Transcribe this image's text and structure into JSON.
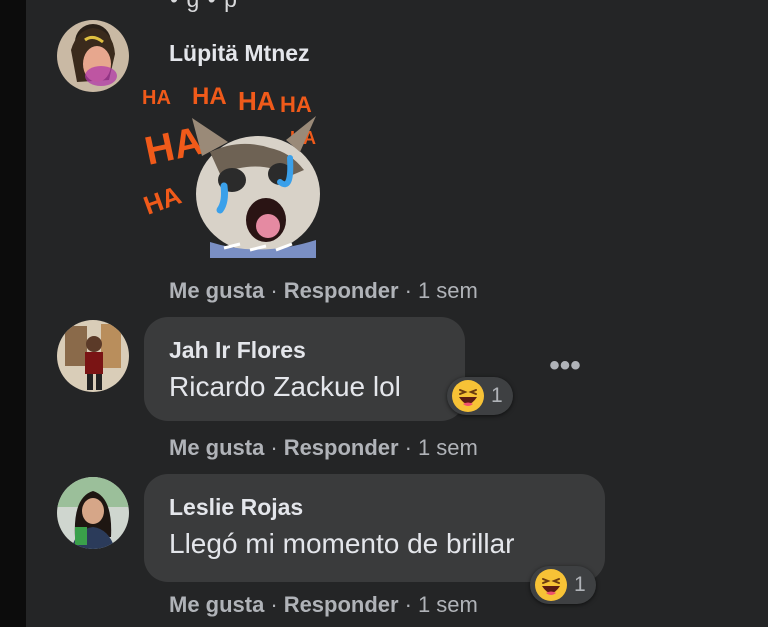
{
  "top_partial_text": "• g • p",
  "comments": [
    {
      "author": "Lüpitä Mtnez",
      "sticker_word": "HA",
      "actions": {
        "like": "Me gusta",
        "reply": "Responder",
        "time": "1 sem"
      }
    },
    {
      "author": "Jah Ir Flores",
      "text": "Ricardo Zackue lol",
      "reaction": {
        "icon": "haha-emoji-icon",
        "count": "1"
      },
      "more_icon": "•••",
      "actions": {
        "like": "Me gusta",
        "reply": "Responder",
        "time": "1 sem"
      }
    },
    {
      "author": "Leslie Rojas",
      "text": "Llegó mi momento de brillar",
      "reaction": {
        "icon": "haha-emoji-icon",
        "count": "1"
      },
      "actions": {
        "like": "Me gusta",
        "reply": "Responder",
        "time": "1 sem"
      }
    }
  ],
  "colors": {
    "background": "#242526",
    "bubble": "#3a3b3c",
    "text": "#e4e6eb",
    "secondary": "#b0b3b8",
    "haha_orange": "#f05a1a"
  }
}
